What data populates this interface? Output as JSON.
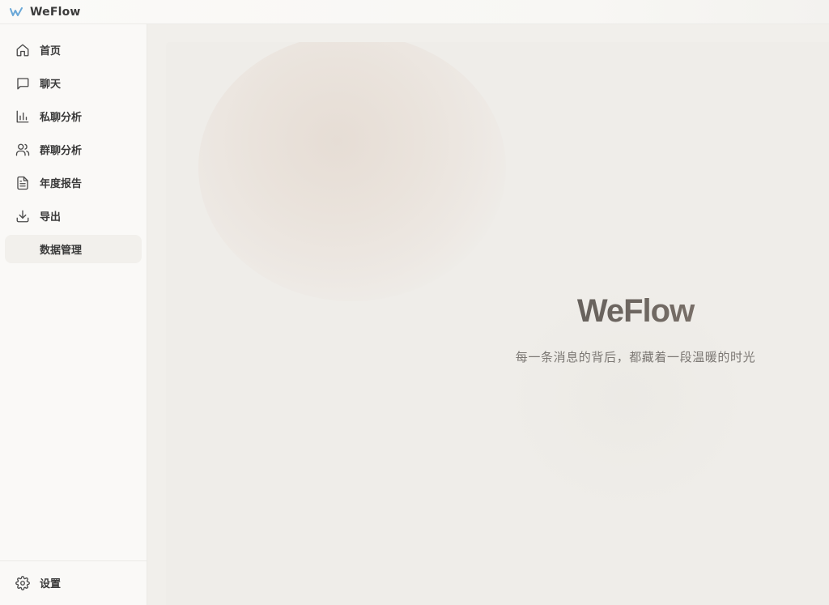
{
  "app": {
    "name": "WeFlow",
    "logo_icon": "weflow-logo-icon",
    "accent_color": "#6aa8d8"
  },
  "sidebar": {
    "items": [
      {
        "label": "首页",
        "icon": "home-icon",
        "active": false
      },
      {
        "label": "聊天",
        "icon": "chat-bubble-icon",
        "active": false
      },
      {
        "label": "私聊分析",
        "icon": "bar-chart-icon",
        "active": false
      },
      {
        "label": "群聊分析",
        "icon": "users-icon",
        "active": false
      },
      {
        "label": "年度报告",
        "icon": "document-icon",
        "active": false
      },
      {
        "label": "导出",
        "icon": "download-icon",
        "active": false
      },
      {
        "label": "数据管理",
        "icon": "",
        "active": true
      }
    ],
    "settings": {
      "label": "设置",
      "icon": "gear-icon"
    }
  },
  "main": {
    "title": "WeFlow",
    "subtitle": "每一条消息的背后，都藏着一段温暖的时光"
  }
}
